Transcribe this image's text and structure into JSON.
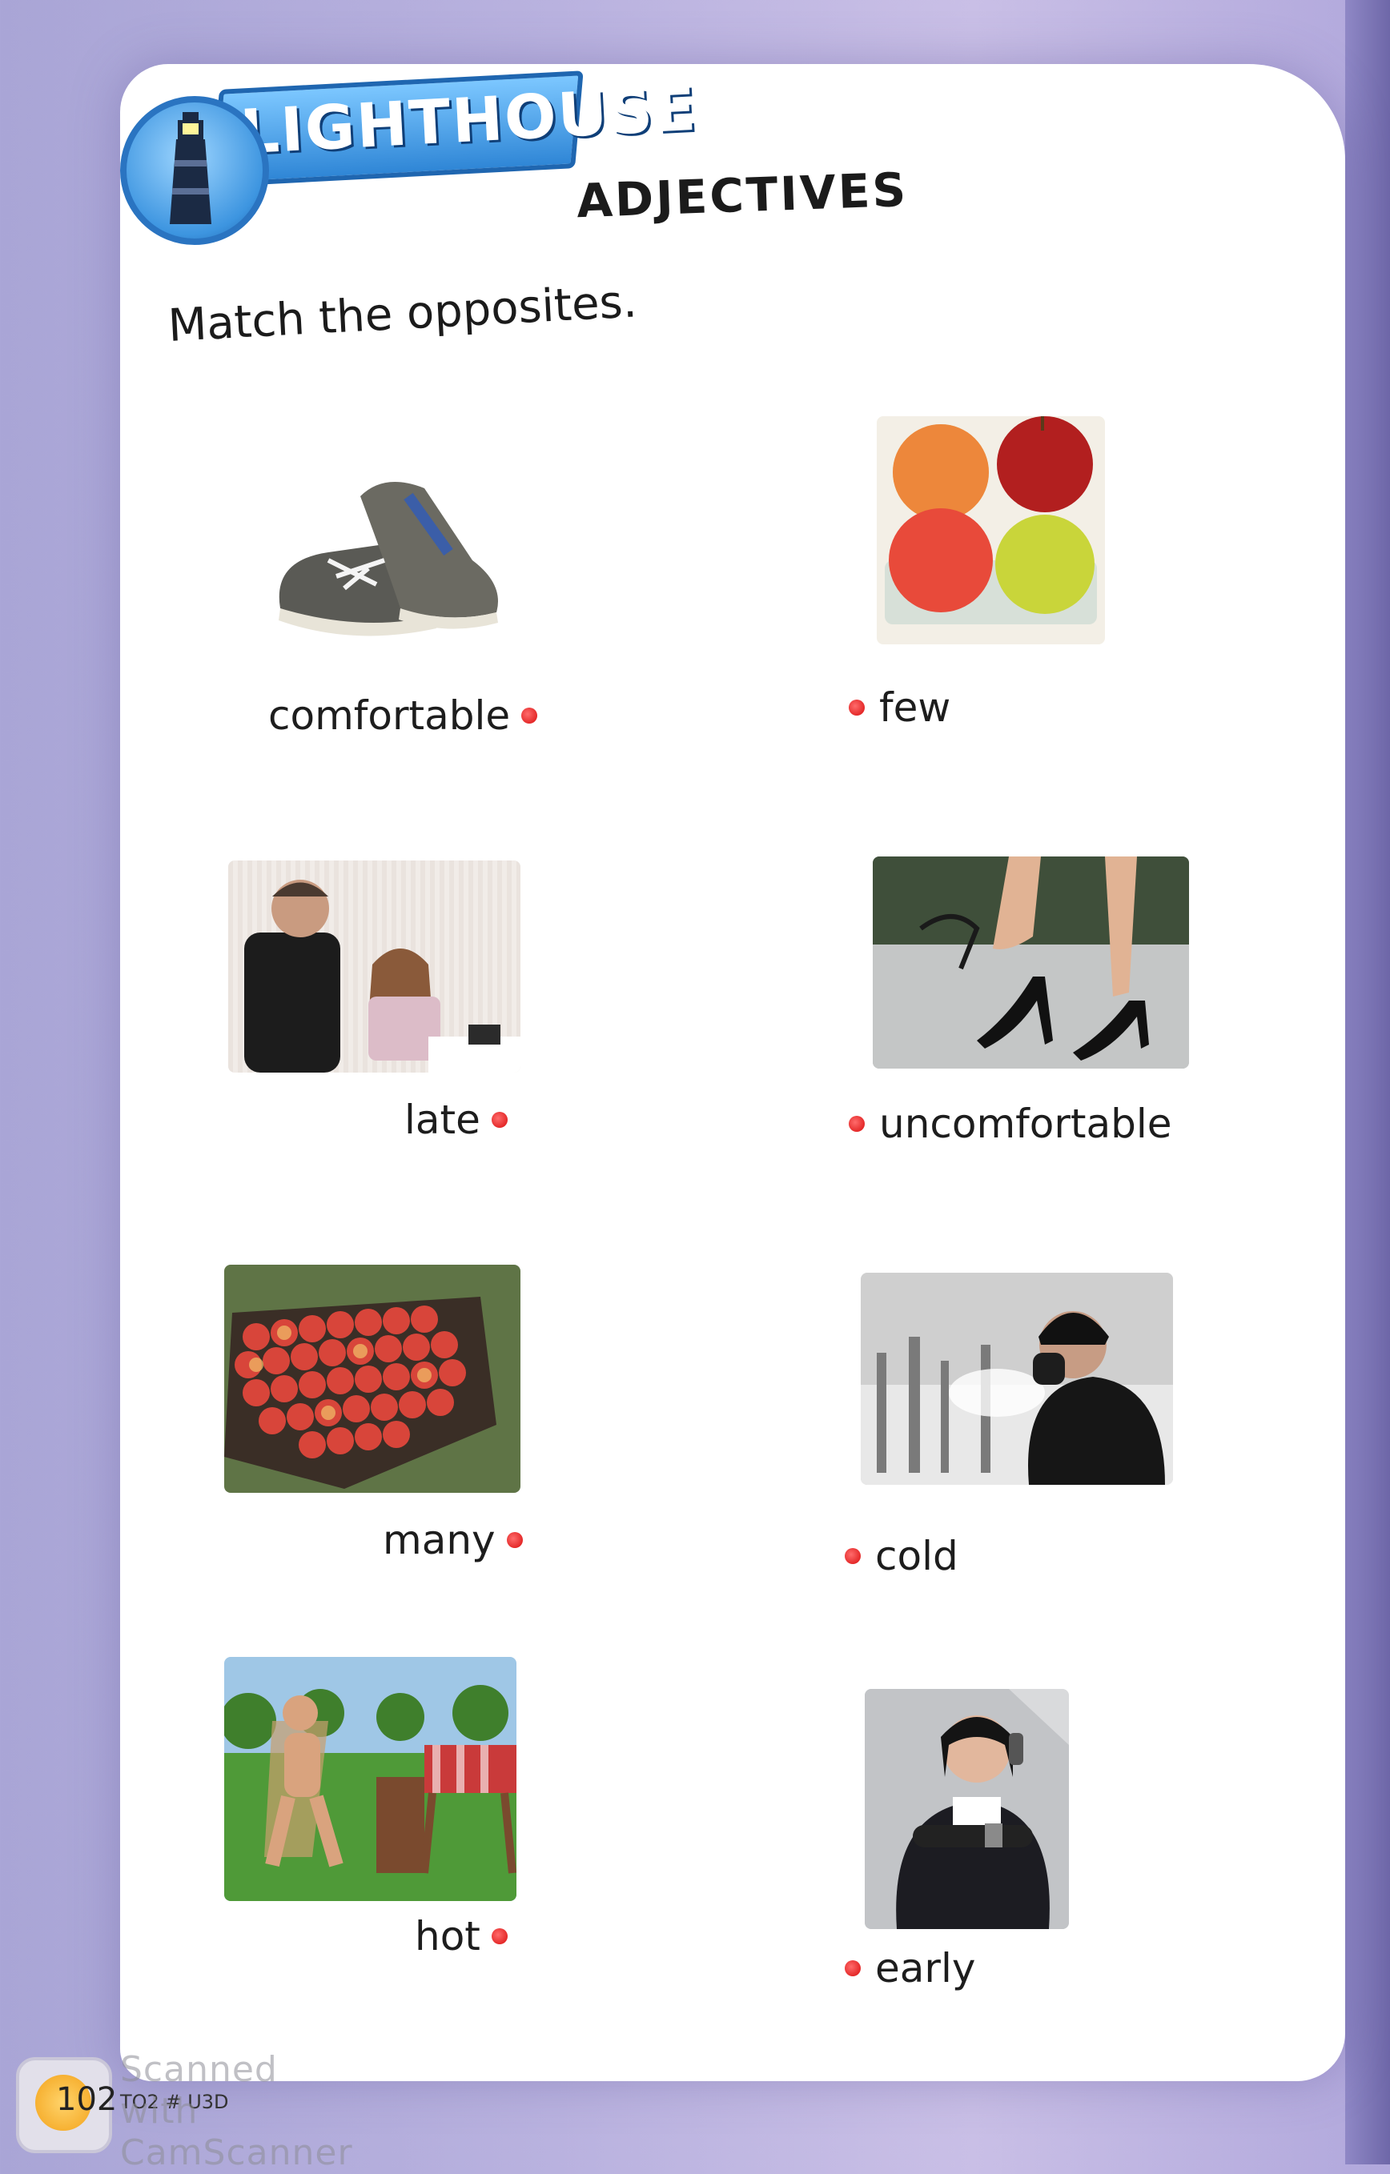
{
  "header": {
    "brand": "LIGHTHOUSE",
    "title": "ADJECTIVES"
  },
  "instruction": "Match the opposites.",
  "left_words": [
    {
      "label": "comfortable",
      "image": "sneakers-photo"
    },
    {
      "label": "late",
      "image": "office-late-photo"
    },
    {
      "label": "many",
      "image": "crate-of-apples-photo"
    },
    {
      "label": "hot",
      "image": "sunbathing-man-photo"
    }
  ],
  "right_words": [
    {
      "label": "few",
      "image": "four-apples-photo"
    },
    {
      "label": "uncomfortable",
      "image": "high-heels-photo"
    },
    {
      "label": "cold",
      "image": "cold-man-photo"
    },
    {
      "label": "early",
      "image": "woman-checking-watch-photo"
    }
  ],
  "footer": {
    "page_number": "102",
    "book_code": "TO2 # U3D",
    "watermark": "Scanned with CamScanner"
  },
  "colors": {
    "dot": "#d90d0d",
    "logo_blue": "#2f86d6",
    "text": "#1b1b1b"
  }
}
